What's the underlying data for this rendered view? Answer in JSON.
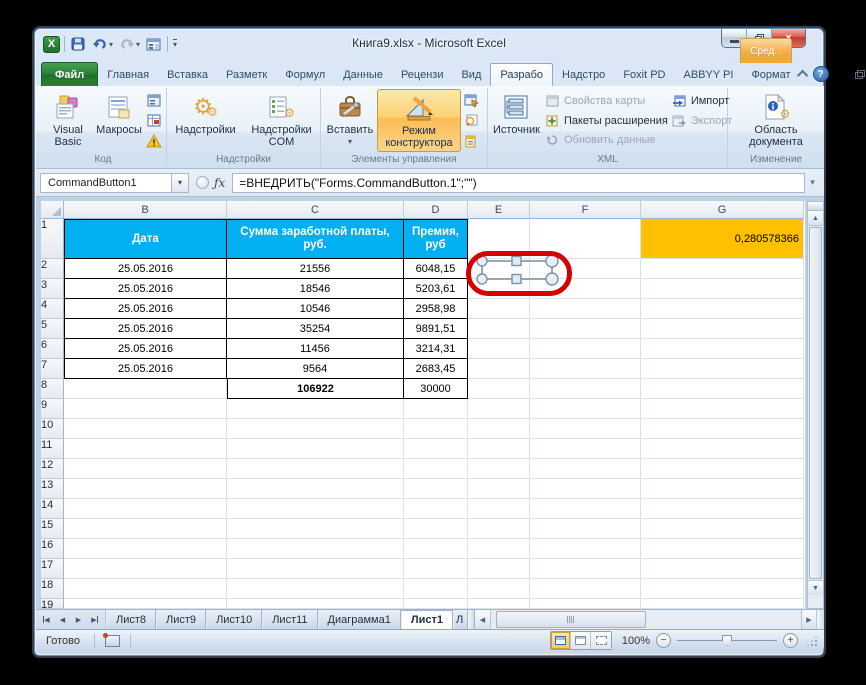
{
  "icons": {
    "dropdown": "▾",
    "gear": "⚙",
    "help": "?",
    "fx": "ƒx",
    "close": "×",
    "nav_prev": "◀",
    "nav_next": "▶",
    "excel_logo": "X",
    "up_arrow": "▲",
    "down_arrow": "▼",
    "formula_expand": "▾",
    "minus": "−",
    "plus": "+"
  },
  "titlebar": {
    "title": "Книга9.xlsx  -  Microsoft Excel",
    "contextual_group_label": "Сред..."
  },
  "tabs": {
    "file": "Файл",
    "items": [
      "Главная",
      "Вставка",
      "Разметк",
      "Формул",
      "Данные",
      "Рецензи",
      "Вид",
      "Разрабо",
      "Надстро",
      "Foxit PD",
      "ABBYY PI",
      "Формат"
    ],
    "active": "Разрабо"
  },
  "ribbon": {
    "groups": {
      "code": {
        "label": "Код",
        "visual_basic": "Visual Basic",
        "macros": "Макросы"
      },
      "addins": {
        "label": "Надстройки",
        "addins": "Надстройки",
        "com_addins": "Надстройки\nCOM"
      },
      "controls": {
        "label": "Элементы управления",
        "insert": "Вставить",
        "design_mode": "Режим\nконструктора"
      },
      "xml": {
        "label": "XML",
        "source": "Источник",
        "map_properties": "Свойства карты",
        "expansion_packs": "Пакеты расширения",
        "refresh_data": "Обновить данные",
        "import": "Импорт",
        "export": "Экспорт"
      },
      "modify": {
        "label": "Изменение",
        "document_panel": "Область\nдокумента"
      }
    }
  },
  "formula_bar": {
    "name_box": "CommandButton1",
    "formula": "=ВНЕДРИТЬ(\"Forms.CommandButton.1\";\"\")"
  },
  "grid": {
    "columns": [
      "B",
      "C",
      "D",
      "E",
      "F",
      "G"
    ],
    "header_row": {
      "n": "1",
      "b": "Дата",
      "c": "Сумма заработной платы, руб.",
      "d": "Премия, руб",
      "g": "0,280578366"
    },
    "data_rows": [
      {
        "n": "2",
        "b": "25.05.2016",
        "c": "21556",
        "d": "6048,15"
      },
      {
        "n": "3",
        "b": "25.05.2016",
        "c": "18546",
        "d": "5203,61"
      },
      {
        "n": "4",
        "b": "25.05.2016",
        "c": "10546",
        "d": "2958,98"
      },
      {
        "n": "5",
        "b": "25.05.2016",
        "c": "35254",
        "d": "9891,51"
      },
      {
        "n": "6",
        "b": "25.05.2016",
        "c": "11456",
        "d": "3214,31"
      },
      {
        "n": "7",
        "b": "25.05.2016",
        "c": "9564",
        "d": "2683,45"
      },
      {
        "n": "8",
        "b": "",
        "c": "106922",
        "d": "30000",
        "total": true
      }
    ],
    "empty_rows": [
      "9",
      "10",
      "11",
      "12",
      "13",
      "14",
      "15",
      "16",
      "17",
      "18"
    ],
    "partial_row": "19"
  },
  "sheet_tabs": {
    "tabs": [
      "Лист8",
      "Лист9",
      "Лист10",
      "Лист11",
      "Диаграмма1",
      "Лист1"
    ],
    "active": "Лист1",
    "overflow": "Л"
  },
  "status_bar": {
    "ready": "Готово",
    "zoom_level": "100%"
  },
  "colors": {
    "header_fill": "#00b0f0",
    "highlight_cell": "#ffc000",
    "annotation_ring": "#d40000",
    "design_mode_bg": "#fbc55f",
    "file_tab": "#2c8039"
  }
}
